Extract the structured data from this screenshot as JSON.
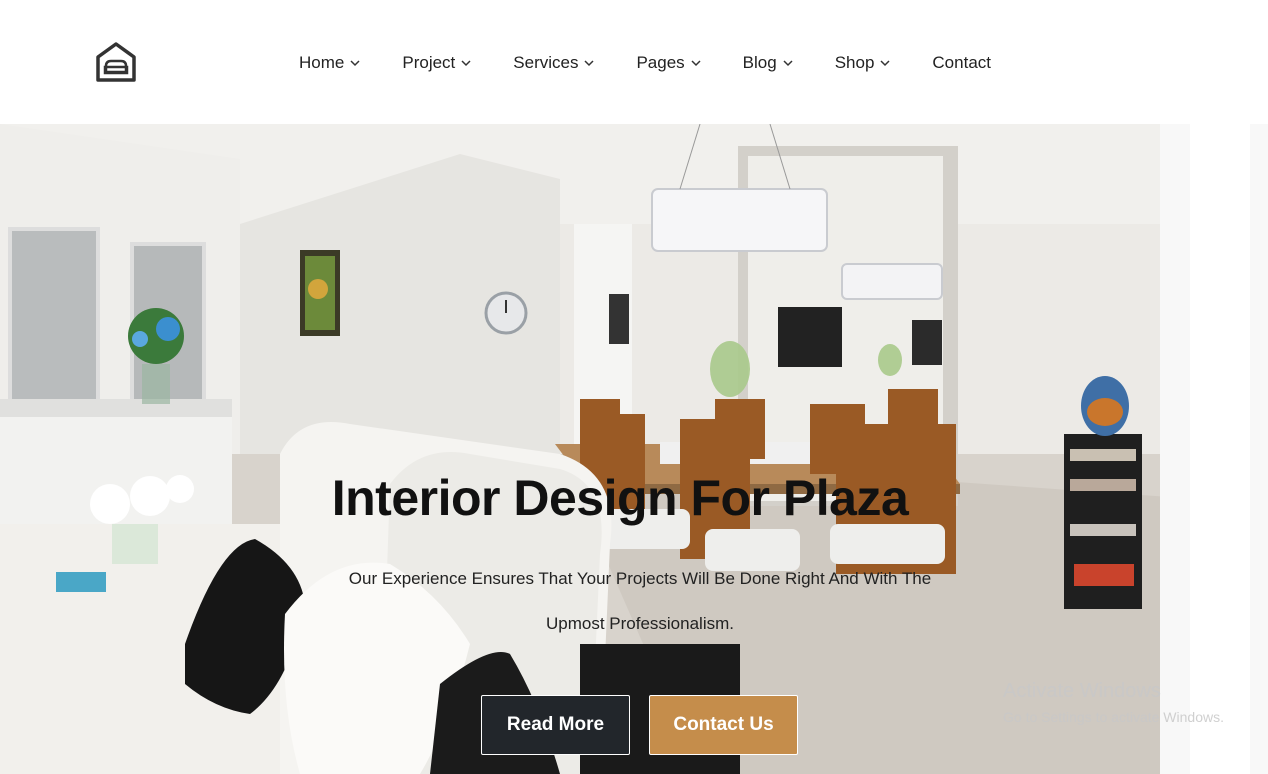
{
  "header": {
    "logo_icon": "house-sofa-icon",
    "nav": [
      {
        "label": "Home",
        "has_dropdown": true
      },
      {
        "label": "Project",
        "has_dropdown": true
      },
      {
        "label": "Services",
        "has_dropdown": true
      },
      {
        "label": "Pages",
        "has_dropdown": true
      },
      {
        "label": "Blog",
        "has_dropdown": true
      },
      {
        "label": "Shop",
        "has_dropdown": true
      },
      {
        "label": "Contact",
        "has_dropdown": false
      }
    ]
  },
  "hero": {
    "title": "Interior Design For Plaza",
    "subtitle": "Our Experience Ensures That Your Projects Will Be Done Right And With The Upmost Professionalism.",
    "buttons": {
      "read_more": "Read More",
      "contact_us": "Contact Us"
    },
    "colors": {
      "dark_button": "#22262b",
      "accent_button": "#c58d4b"
    }
  },
  "watermark": {
    "line1": "Activate Windows",
    "line2": "Go to Settings to activate Windows."
  }
}
